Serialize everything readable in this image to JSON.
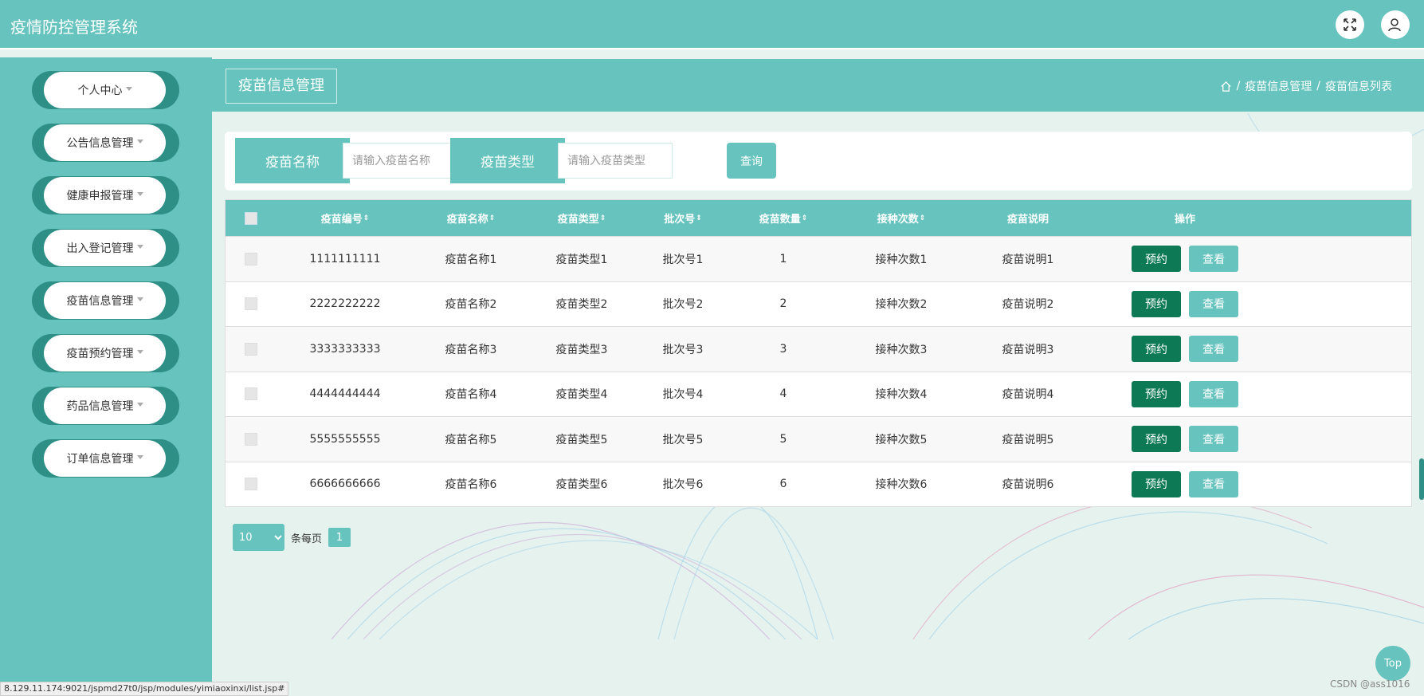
{
  "header": {
    "app_title": "疫情防控管理系统",
    "fullscreen_icon": "expand-icon",
    "user_icon": "user-icon"
  },
  "sidebar": {
    "items": [
      {
        "label": "个人中心"
      },
      {
        "label": "公告信息管理"
      },
      {
        "label": "健康申报管理"
      },
      {
        "label": "出入登记管理"
      },
      {
        "label": "疫苗信息管理"
      },
      {
        "label": "疫苗预约管理"
      },
      {
        "label": "药品信息管理"
      },
      {
        "label": "订单信息管理"
      }
    ]
  },
  "page": {
    "title": "疫苗信息管理",
    "breadcrumb": [
      "疫苗信息管理",
      "疫苗信息列表"
    ]
  },
  "search": {
    "name_label": "疫苗名称",
    "name_placeholder": "请输入疫苗名称",
    "type_label": "疫苗类型",
    "type_placeholder": "请输入疫苗类型",
    "button_label": "查询"
  },
  "table": {
    "columns": [
      "疫苗编号",
      "疫苗名称",
      "疫苗类型",
      "批次号",
      "疫苗数量",
      "接种次数",
      "疫苗说明",
      "操作"
    ],
    "sortable": [
      true,
      true,
      true,
      true,
      true,
      true,
      false,
      false
    ],
    "sort_glyph": "⇕",
    "rows": [
      [
        "1111111111",
        "疫苗名称1",
        "疫苗类型1",
        "批次号1",
        "1",
        "接种次数1",
        "疫苗说明1"
      ],
      [
        "2222222222",
        "疫苗名称2",
        "疫苗类型2",
        "批次号2",
        "2",
        "接种次数2",
        "疫苗说明2"
      ],
      [
        "3333333333",
        "疫苗名称3",
        "疫苗类型3",
        "批次号3",
        "3",
        "接种次数3",
        "疫苗说明3"
      ],
      [
        "4444444444",
        "疫苗名称4",
        "疫苗类型4",
        "批次号4",
        "4",
        "接种次数4",
        "疫苗说明4"
      ],
      [
        "5555555555",
        "疫苗名称5",
        "疫苗类型5",
        "批次号5",
        "5",
        "接种次数5",
        "疫苗说明5"
      ],
      [
        "6666666666",
        "疫苗名称6",
        "疫苗类型6",
        "批次号6",
        "6",
        "接种次数6",
        "疫苗说明6"
      ]
    ],
    "action_book": "预约",
    "action_view": "查看"
  },
  "pagination": {
    "page_size": "10",
    "per_page_label": "条每页",
    "current_page": "1"
  },
  "float_top": "Top",
  "status_url": "8.129.11.174:9021/jspmd27t0/jsp/modules/yimiaoxinxi/list.jsp#",
  "watermark": "CSDN @ass1016",
  "colors": {
    "primary": "#66c3be",
    "dark_teal": "#2e8f86",
    "book_button": "#0d7a55"
  }
}
